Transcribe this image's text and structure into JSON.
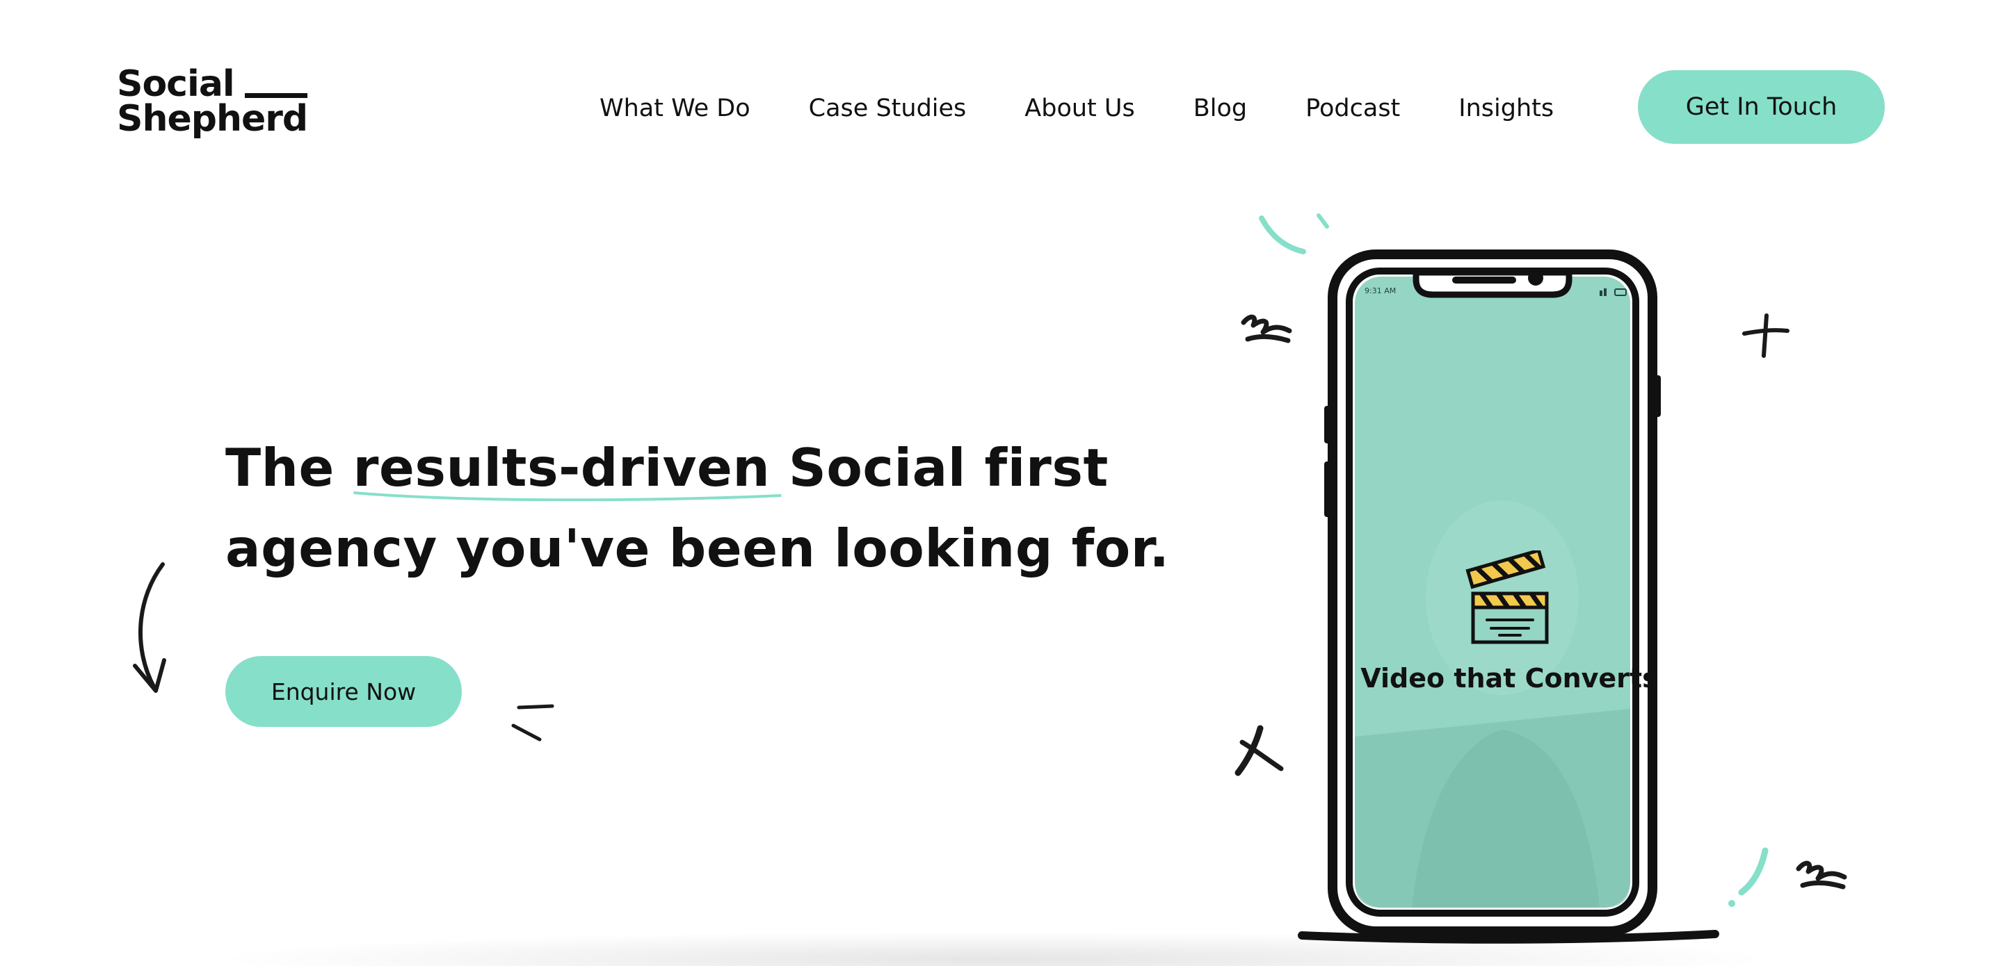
{
  "brand": {
    "line1": "Social",
    "line2": "Shepherd"
  },
  "nav": {
    "items": [
      "What We Do",
      "Case Studies",
      "About Us",
      "Blog",
      "Podcast",
      "Insights"
    ],
    "cta_label": "Get In Touch"
  },
  "hero": {
    "title_before": "The ",
    "title_highlight": "results-driven",
    "title_after_line1": " Social first",
    "title_line2": "agency you've been looking for.",
    "cta_label": "Enquire Now"
  },
  "phone": {
    "status_time": "9:31 AM",
    "screen_caption": "Video that Converts",
    "icon": "clapperboard-icon"
  },
  "colors": {
    "accent": "#86dfc9",
    "phone_screen": "#94d5c3",
    "text": "#111111",
    "clapper_stripe": "#f2c94c"
  }
}
